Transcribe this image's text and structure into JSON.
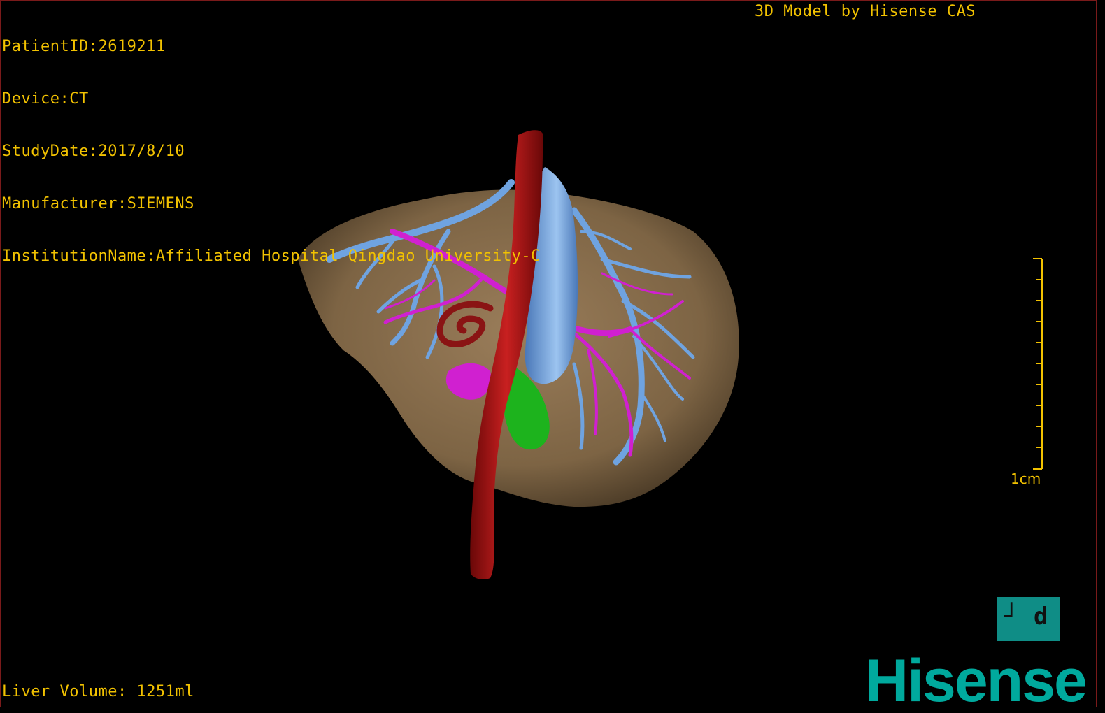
{
  "header": {
    "patient_id": "PatientID:2619211",
    "device": "Device:CT",
    "study_date": "StudyDate:2017/8/10",
    "manufacturer": "Manufacturer:SIEMENS",
    "institution": "InstitutionName:Affiliated Hospital Qingdao University-C"
  },
  "brand": {
    "model_credit": "3D Model by Hisense CAS",
    "logo_text": "Hisense",
    "logo_box_left_glyph": "┘",
    "logo_box_right_glyph": "d"
  },
  "footer": {
    "liver_volume": "Liver Volume: 1251ml"
  },
  "scale": {
    "label": "1cm"
  },
  "colors": {
    "overlay_text": "#f2c200",
    "liver": "#8b7150",
    "hepatic_vein": "#6fa3e0",
    "portal_vein": "#d020d0",
    "aorta": "#b01818",
    "gallbladder": "#1db31d",
    "brand": "#00a99d"
  }
}
